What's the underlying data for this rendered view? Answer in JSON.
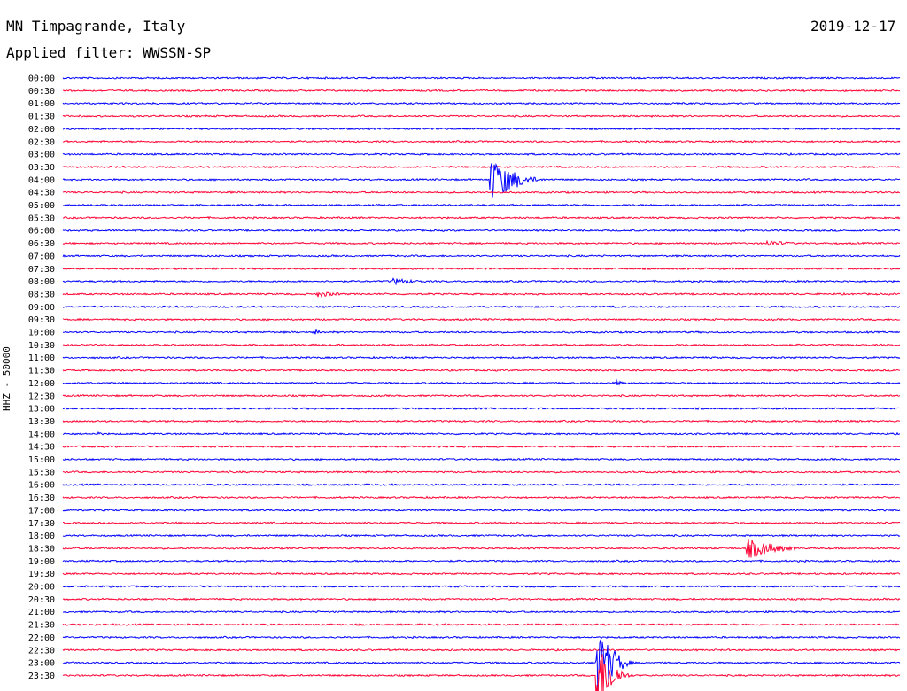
{
  "header": {
    "station": "MN Timpagrande, Italy",
    "filter": "Applied filter: WWSSN-SP",
    "date": "2019-12-17",
    "channel": "HHZ - 50000"
  },
  "chart_data": {
    "type": "line",
    "title": "MN Timpagrande, Italy",
    "subtitle": "Applied filter: WWSSN-SP",
    "date": "2019-12-17",
    "ylabel": "HHZ - 50000",
    "row_minutes": 30,
    "colors": {
      "even": "#0000ff",
      "odd": "#ff0033"
    },
    "rows": [
      "00:00",
      "00:30",
      "01:00",
      "01:30",
      "02:00",
      "02:30",
      "03:00",
      "03:30",
      "04:00",
      "04:30",
      "05:00",
      "05:30",
      "06:00",
      "06:30",
      "07:00",
      "07:30",
      "08:00",
      "08:30",
      "09:00",
      "09:30",
      "10:00",
      "10:30",
      "11:00",
      "11:30",
      "12:00",
      "12:30",
      "13:00",
      "13:30",
      "14:00",
      "14:30",
      "15:00",
      "15:30",
      "16:00",
      "16:30",
      "17:00",
      "17:30",
      "18:00",
      "18:30",
      "19:00",
      "19:30",
      "20:00",
      "20:30",
      "21:00",
      "21:30",
      "22:00",
      "22:30",
      "23:00",
      "23:30"
    ],
    "events": [
      {
        "row": "04:00",
        "start_min": 15.3,
        "dur_min": 2.1,
        "amp": 24
      },
      {
        "row": "18:30",
        "start_min": 24.5,
        "dur_min": 2.2,
        "amp": 11
      },
      {
        "row": "23:00",
        "start_min": 19.1,
        "dur_min": 1.5,
        "amp": 40
      },
      {
        "row": "23:30",
        "start_min": 19.1,
        "dur_min": 1.4,
        "amp": 38
      },
      {
        "row": "08:00",
        "start_min": 11.8,
        "dur_min": 1.5,
        "amp": 3
      },
      {
        "row": "08:30",
        "start_min": 9.1,
        "dur_min": 1.2,
        "amp": 3
      },
      {
        "row": "06:30",
        "start_min": 25.2,
        "dur_min": 1.2,
        "amp": 3
      },
      {
        "row": "10:00",
        "start_min": 9.0,
        "dur_min": 0.3,
        "amp": 5
      },
      {
        "row": "14:00",
        "start_min": 1.2,
        "dur_min": 0.2,
        "amp": 5
      },
      {
        "row": "12:00",
        "start_min": 19.8,
        "dur_min": 0.5,
        "amp": 3
      }
    ]
  }
}
